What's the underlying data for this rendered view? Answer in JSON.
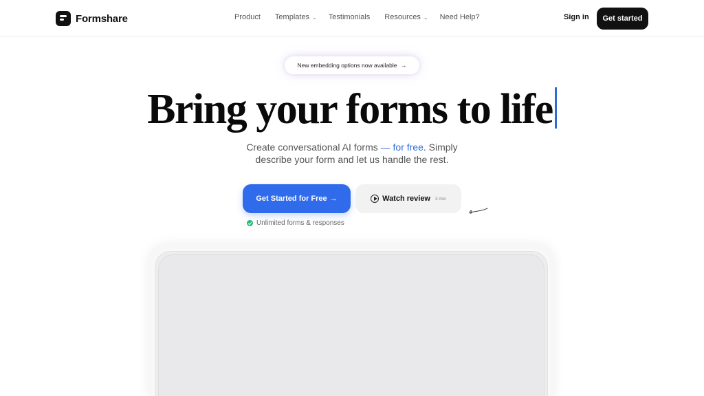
{
  "brand": {
    "name": "Formshare",
    "logo_icon": "formshare-logo-icon"
  },
  "nav": {
    "items": [
      {
        "label": "Product",
        "dropdown": false
      },
      {
        "label": "Templates",
        "dropdown": true
      },
      {
        "label": "Testimonials",
        "dropdown": false
      },
      {
        "label": "Resources",
        "dropdown": true
      },
      {
        "label": "Need Help?",
        "dropdown": false
      }
    ],
    "sign_in": "Sign in",
    "get_started": "Get started"
  },
  "announcement": {
    "text": "New embedding options now available",
    "arrow": "→"
  },
  "hero": {
    "title": "Bring your forms to life",
    "subtitle_part1": "Create conversational AI forms ",
    "subtitle_accent": "— for free",
    "subtitle_part2": ". Simply",
    "subtitle_line2": "describe your form and let us handle the rest."
  },
  "cta": {
    "primary": "Get Started for Free",
    "primary_arrow": "→",
    "secondary": "Watch review",
    "secondary_duration": "3 min",
    "note": "Unlimited forms & responses"
  },
  "colors": {
    "accent": "#2f6bea",
    "dark": "#111111",
    "check": "#2bb673"
  }
}
